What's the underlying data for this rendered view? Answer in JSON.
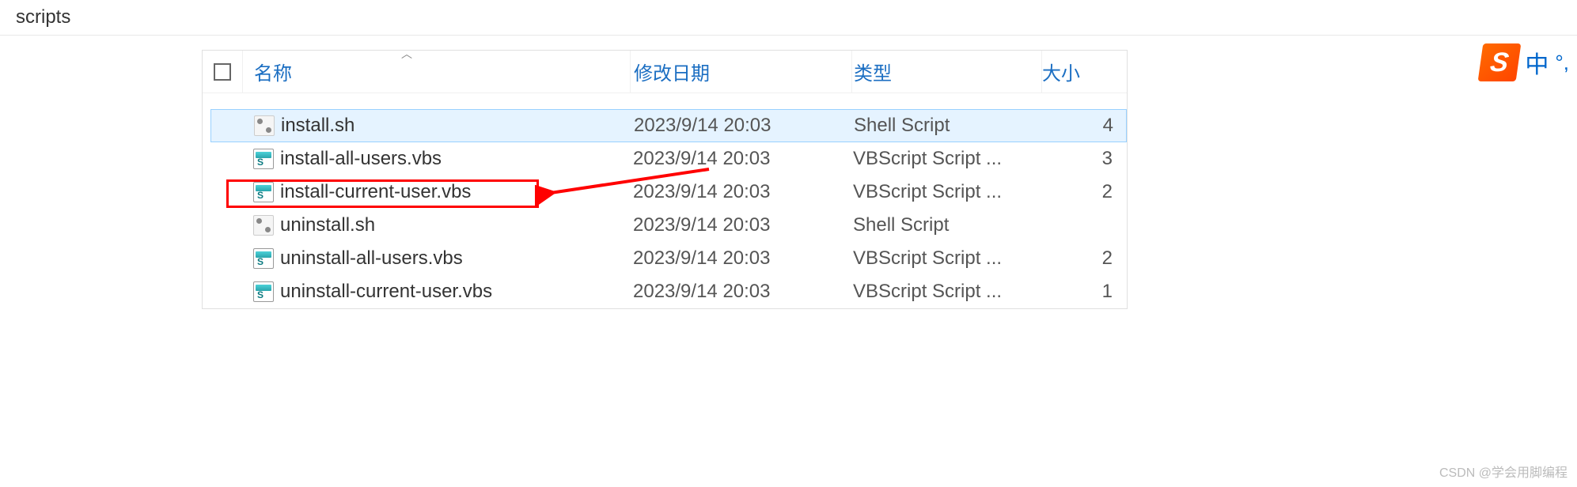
{
  "title": "scripts",
  "columns": {
    "name": "名称",
    "date": "修改日期",
    "type": "类型",
    "size": "大小"
  },
  "files": [
    {
      "name": "install.sh",
      "date": "2023/9/14 20:03",
      "type": "Shell Script",
      "size": "4",
      "icon": "sh",
      "selected": true
    },
    {
      "name": "install-all-users.vbs",
      "date": "2023/9/14 20:03",
      "type": "VBScript Script ...",
      "size": "3",
      "icon": "vbs",
      "selected": false
    },
    {
      "name": "install-current-user.vbs",
      "date": "2023/9/14 20:03",
      "type": "VBScript Script ...",
      "size": "2",
      "icon": "vbs",
      "selected": false,
      "highlighted": true
    },
    {
      "name": "uninstall.sh",
      "date": "2023/9/14 20:03",
      "type": "Shell Script",
      "size": "",
      "icon": "sh",
      "selected": false
    },
    {
      "name": "uninstall-all-users.vbs",
      "date": "2023/9/14 20:03",
      "type": "VBScript Script ...",
      "size": "2",
      "icon": "vbs",
      "selected": false
    },
    {
      "name": "uninstall-current-user.vbs",
      "date": "2023/9/14 20:03",
      "type": "VBScript Script ...",
      "size": "1",
      "icon": "vbs",
      "selected": false
    }
  ],
  "ime": {
    "logo": "S",
    "mode": "中",
    "punct": "°,"
  },
  "watermark": "CSDN @学会用脚编程"
}
